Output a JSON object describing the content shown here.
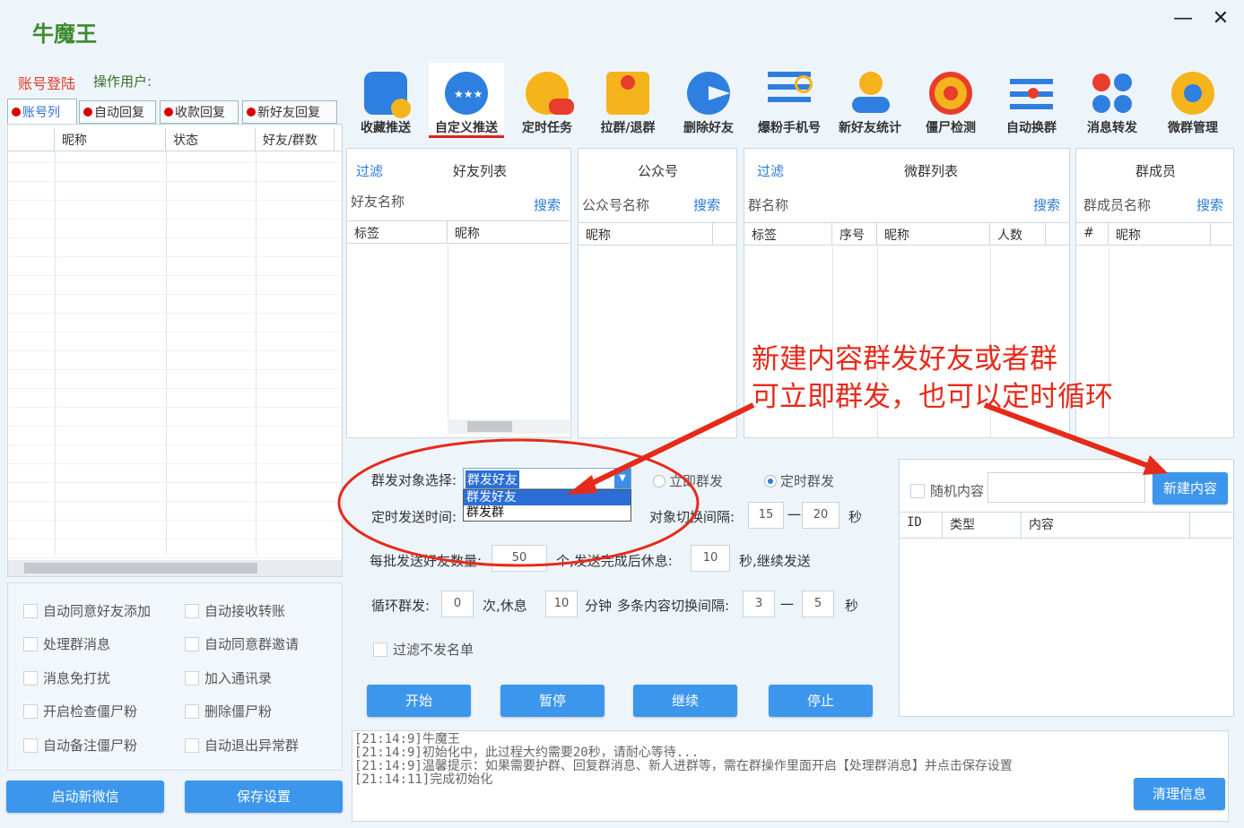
{
  "app": {
    "title": "牛魔王"
  },
  "account": {
    "login_label": "账号登陆",
    "operator_label": "操作用户:"
  },
  "tabs": [
    "账号列",
    "自动回复",
    "收款回复",
    "新好友回复"
  ],
  "account_table": {
    "headers": [
      "",
      "昵称",
      "状态",
      "好友/群数"
    ]
  },
  "toolbar": [
    {
      "label": "收藏推送",
      "icon": "bookmark-clock-icon"
    },
    {
      "label": "自定义推送",
      "icon": "chat-stars-icon"
    },
    {
      "label": "定时任务",
      "icon": "user-chat-icon"
    },
    {
      "label": "拉群/退群",
      "icon": "org-tree-icon"
    },
    {
      "label": "删除好友",
      "icon": "pacman-icon"
    },
    {
      "label": "爆粉手机号",
      "icon": "list-search-icon"
    },
    {
      "label": "新好友统计",
      "icon": "new-user-icon"
    },
    {
      "label": "僵尸检测",
      "icon": "target-icon"
    },
    {
      "label": "自动换群",
      "icon": "sliders-icon"
    },
    {
      "label": "消息转发",
      "icon": "grid-dots-icon"
    },
    {
      "label": "微群管理",
      "icon": "gear-icon"
    }
  ],
  "friends": {
    "filter": "过滤",
    "title": "好友列表",
    "name_label": "好友名称",
    "search": "搜索",
    "headers": [
      "标签",
      "昵称"
    ]
  },
  "official": {
    "title": "公众号",
    "name_label": "公众号名称",
    "search": "搜索",
    "headers": [
      "昵称"
    ]
  },
  "groups": {
    "filter": "过滤",
    "title": "微群列表",
    "name_label": "群名称",
    "search": "搜索",
    "headers": [
      "标签",
      "序号",
      "昵称",
      "人数"
    ]
  },
  "members": {
    "title": "群成员",
    "name_label": "群成员名称",
    "search": "搜索",
    "headers": [
      "#",
      "昵称"
    ]
  },
  "send": {
    "target_label": "群发对象选择:",
    "target_value": "群发好友",
    "target_options": [
      "群发好友",
      "群发群"
    ],
    "immediate": "立即群发",
    "scheduled": "定时群发",
    "time_label": "定时发送时间:",
    "switch_label": "对象切换间隔:",
    "switch_min": "15",
    "switch_dash": "一",
    "switch_max": "20",
    "switch_unit": "秒",
    "batch_label": "每批发送好友数量:",
    "batch_value": "50",
    "batch_unit": "个,发送完成后休息:",
    "rest_value": "10",
    "rest_unit": "秒,继续发送",
    "loop_label": "循环群发:",
    "loop_value": "0",
    "loop_unit": "次,休息",
    "loop_rest": "10",
    "loop_rest_unit": "分钟",
    "multi_label": "多条内容切换间隔:",
    "multi_min": "3",
    "multi_dash": "一",
    "multi_max": "5",
    "multi_unit": "秒",
    "filter_blacklist": "过滤不发名单"
  },
  "actions": {
    "start": "开始",
    "pause": "暂停",
    "resume": "继续",
    "stop": "停止"
  },
  "content": {
    "random": "随机内容",
    "new_button": "新建内容",
    "headers": [
      "ID",
      "类型",
      "内容"
    ]
  },
  "options": {
    "left": [
      "自动同意好友添加",
      "处理群消息",
      "消息免打扰",
      "开启检查僵尸粉",
      "自动备注僵尸粉"
    ],
    "right": [
      "自动接收转账",
      "自动同意群邀请",
      "加入通讯录",
      "删除僵尸粉",
      "自动退出异常群"
    ]
  },
  "bottom": {
    "launch": "启动新微信",
    "save": "保存设置",
    "clear": "清理信息"
  },
  "log": [
    "[21:14:9]牛魔王",
    "[21:14:9]初始化中，此过程大约需要20秒，请耐心等待...",
    "[21:14:9]温馨提示：如果需要护群、回复群消息、新人进群等，需在群操作里面开启【处理群消息】并点击保存设置",
    "[21:14:11]完成初始化"
  ],
  "annotation": {
    "line1": "新建内容群发好友或者群",
    "line2": "可立即群发，也可以定时循环",
    "color": "#e62a1a"
  }
}
